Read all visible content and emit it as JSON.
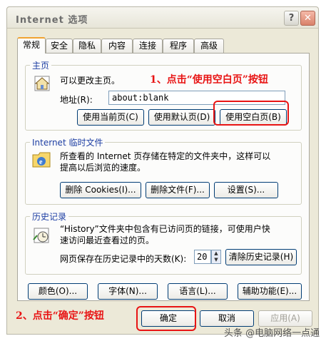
{
  "window": {
    "title": "Internet 选项"
  },
  "tabs": [
    "常规",
    "安全",
    "隐私",
    "内容",
    "连接",
    "程序",
    "高级"
  ],
  "home": {
    "group_label": "主页",
    "description": "可以更改主页。",
    "address_label": "地址(R):",
    "address_value": "about:blank",
    "btn_current": "使用当前页(C)",
    "btn_default": "使用默认页(D)",
    "btn_blank": "使用空白页(B)"
  },
  "temp": {
    "group_label": "Internet 临时文件",
    "line1": "所查看的 Internet 页存储在特定的文件夹中，这样可以",
    "line2": "提高以后浏览的速度。",
    "btn_cookies": "删除 Cookies(I)...",
    "btn_files": "删除文件(F)...",
    "btn_settings": "设置(S)..."
  },
  "history": {
    "group_label": "历史记录",
    "line1": "“History”文件夹中包含有已访问页的链接，可使用户快",
    "line2": "速访问最近查看过的页。",
    "days_label": "网页保存在历史记录中的天数(K):",
    "days_value": "20",
    "btn_clear": "清除历史记录(H)"
  },
  "bottom": {
    "colors": "颜色(O)...",
    "fonts": "字体(N)...",
    "languages": "语言(L)...",
    "accessibility": "辅助功能(E)..."
  },
  "dialog": {
    "ok": "确定",
    "cancel": "取消",
    "apply": "应用(A)"
  },
  "annotations": {
    "step1": "1、点击“使用空白页”按钮",
    "step2": "2、点击“确定”按钮"
  },
  "watermark": "头条 @电脑网络一点通",
  "colors": {
    "annotation": "#e81414",
    "tab_highlight": "#f1a331",
    "group_label": "#1d3ea3"
  }
}
